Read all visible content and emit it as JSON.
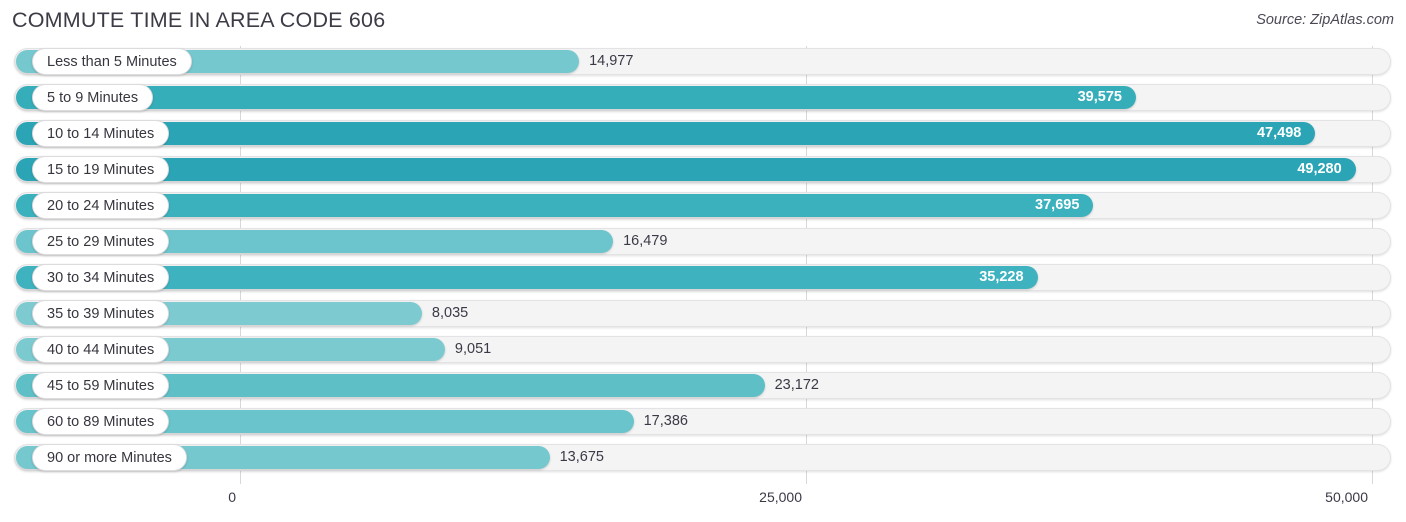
{
  "header": {
    "title": "COMMUTE TIME IN AREA CODE 606",
    "source": "Source: ZipAtlas.com"
  },
  "axis": {
    "ticks": [
      "0",
      "25,000",
      "50,000"
    ]
  },
  "colors": {
    "bar_light": "#74c8ce",
    "bar_mid": "#5bbcc6",
    "bar_dark": "#2ba5b5",
    "track": "#f4f4f4",
    "gridline": "#d8d8dc",
    "text": "#3a3a46"
  },
  "chart_data": {
    "type": "bar",
    "orientation": "horizontal",
    "title": "COMMUTE TIME IN AREA CODE 606",
    "subtitle": "Source: ZipAtlas.com",
    "xlabel": "",
    "ylabel": "",
    "xlim": [
      0,
      50000
    ],
    "xticks": [
      0,
      25000,
      50000
    ],
    "xticklabels": [
      "0",
      "25,000",
      "50,000"
    ],
    "grid": true,
    "legend": false,
    "categories": [
      "Less than 5 Minutes",
      "5 to 9 Minutes",
      "10 to 14 Minutes",
      "15 to 19 Minutes",
      "20 to 24 Minutes",
      "25 to 29 Minutes",
      "30 to 34 Minutes",
      "35 to 39 Minutes",
      "40 to 44 Minutes",
      "45 to 59 Minutes",
      "60 to 89 Minutes",
      "90 or more Minutes"
    ],
    "values": [
      14977,
      39575,
      47498,
      49280,
      37695,
      16479,
      35228,
      8035,
      9051,
      23172,
      17386,
      13675
    ],
    "value_labels": [
      "14,977",
      "39,575",
      "47,498",
      "49,280",
      "37,695",
      "16,479",
      "35,228",
      "8,035",
      "9,051",
      "23,172",
      "17,386",
      "13,675"
    ]
  },
  "rows": [
    {
      "label": "Less than 5 Minutes",
      "value": 14977,
      "value_label": "14,977",
      "color": "#74c8ce",
      "inside": false
    },
    {
      "label": "5 to 9 Minutes",
      "value": 39575,
      "value_label": "39,575",
      "color": "#35aeba",
      "inside": true
    },
    {
      "label": "10 to 14 Minutes",
      "value": 47498,
      "value_label": "47,498",
      "color": "#2ba5b5",
      "inside": true
    },
    {
      "label": "15 to 19 Minutes",
      "value": 49280,
      "value_label": "49,280",
      "color": "#2ba5b5",
      "inside": true
    },
    {
      "label": "20 to 24 Minutes",
      "value": 37695,
      "value_label": "37,695",
      "color": "#3ab1bd",
      "inside": true
    },
    {
      "label": "25 to 29 Minutes",
      "value": 16479,
      "value_label": "16,479",
      "color": "#6cc5cc",
      "inside": false
    },
    {
      "label": "30 to 34 Minutes",
      "value": 35228,
      "value_label": "35,228",
      "color": "#3eb3bf",
      "inside": true
    },
    {
      "label": "35 to 39 Minutes",
      "value": 8035,
      "value_label": "8,035",
      "color": "#7dcbd1",
      "inside": false
    },
    {
      "label": "40 to 44 Minutes",
      "value": 9051,
      "value_label": "9,051",
      "color": "#7bcad0",
      "inside": false
    },
    {
      "label": "45 to 59 Minutes",
      "value": 23172,
      "value_label": "23,172",
      "color": "#5ebfc7",
      "inside": false
    },
    {
      "label": "60 to 89 Minutes",
      "value": 17386,
      "value_label": "17,386",
      "color": "#69c4cb",
      "inside": false
    },
    {
      "label": "90 or more Minutes",
      "value": 13675,
      "value_label": "13,675",
      "color": "#74c8ce",
      "inside": false
    }
  ]
}
